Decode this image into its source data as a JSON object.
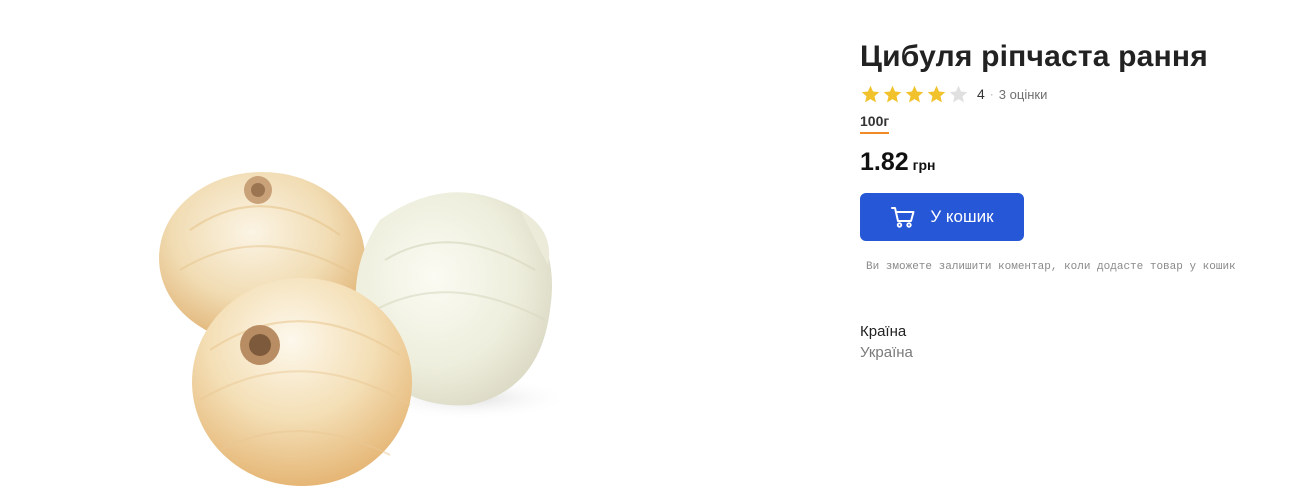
{
  "product": {
    "title": "Цибуля ріпчаста рання",
    "image_alt": "onions-product-image"
  },
  "rating": {
    "value": "4",
    "stars_filled": 4,
    "stars_total": 5,
    "count_text": "3 оцінки",
    "star_color": "#f2c22c",
    "star_empty_color": "#e0e0e0"
  },
  "weight": {
    "selected": "100г",
    "accent": "#f08a24"
  },
  "price": {
    "amount": "1.82",
    "currency": "грн"
  },
  "cart": {
    "button_label": "У кошик",
    "icon": "cart-icon",
    "color": "#2557d6"
  },
  "hint": {
    "text": "Ви зможете залишити коментар, коли додасте товар у кошик"
  },
  "attributes": {
    "country_label": "Країна",
    "country_value": "Україна"
  }
}
